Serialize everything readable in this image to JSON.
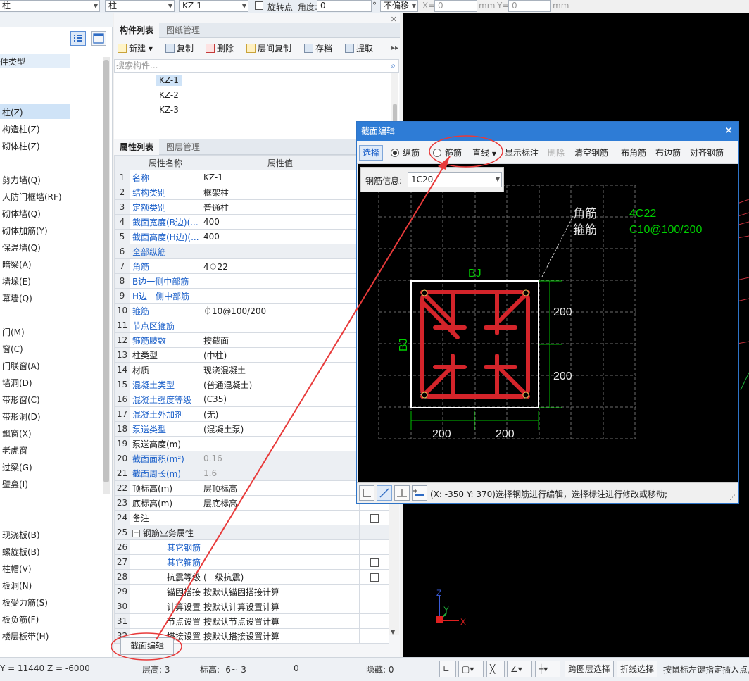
{
  "topbar": {
    "combo1": "柱",
    "combo2": "柱",
    "combo3": "KZ-1",
    "rotate_label": "旋转点",
    "angle_label": "角度:",
    "angle_value": "0",
    "degree": "°",
    "offset_value": "不偏移",
    "x_label": "X=",
    "x_value": "0",
    "mm1": "mm",
    "y_label": "Y=",
    "y_value": "0",
    "mm2": "mm"
  },
  "left_panel": {
    "header_partial": "件类型",
    "items": [
      {
        "label": "柱(Z)"
      },
      {
        "label": "构造柱(Z)"
      },
      {
        "label": "砌体柱(Z)"
      },
      {
        "label": "剪力墙(Q)"
      },
      {
        "label": "人防门框墙(RF)"
      },
      {
        "label": "砌体墙(Q)"
      },
      {
        "label": "砌体加筋(Y)"
      },
      {
        "label": "保温墙(Q)"
      },
      {
        "label": "暗梁(A)"
      },
      {
        "label": "墙垛(E)"
      },
      {
        "label": "幕墙(Q)"
      },
      {
        "label": "门(M)"
      },
      {
        "label": "窗(C)"
      },
      {
        "label": "门联窗(A)"
      },
      {
        "label": "墙洞(D)"
      },
      {
        "label": "带形窗(C)"
      },
      {
        "label": "带形洞(D)"
      },
      {
        "label": "飘窗(X)"
      },
      {
        "label": "老虎窗"
      },
      {
        "label": "过梁(G)"
      },
      {
        "label": "壁龛(I)"
      },
      {
        "label": "现浇板(B)"
      },
      {
        "label": "螺旋板(B)"
      },
      {
        "label": "柱帽(V)"
      },
      {
        "label": "板洞(N)"
      },
      {
        "label": "板受力筋(S)"
      },
      {
        "label": "板负筋(F)"
      },
      {
        "label": "楼层板带(H)"
      }
    ]
  },
  "component_panel": {
    "tab_active": "构件列表",
    "tab_other": "图纸管理",
    "toolbar": [
      "新建",
      "复制",
      "删除",
      "层间复制",
      "存档",
      "提取"
    ],
    "search_placeholder": "搜索构件...",
    "items": [
      "KZ-1",
      "KZ-2",
      "KZ-3"
    ]
  },
  "property_panel": {
    "tab_active": "属性列表",
    "tab_other": "图层管理",
    "col_name": "属性名称",
    "col_value": "属性值",
    "rows": [
      {
        "no": "1",
        "name": "名称",
        "value": "KZ-1"
      },
      {
        "no": "2",
        "name": "结构类别",
        "value": "框架柱"
      },
      {
        "no": "3",
        "name": "定额类别",
        "value": "普通柱"
      },
      {
        "no": "4",
        "name": "截面宽度(B边)(...",
        "value": "400"
      },
      {
        "no": "5",
        "name": "截面高度(H边)(...",
        "value": "400"
      },
      {
        "no": "6",
        "name": "全部纵筋",
        "value": ""
      },
      {
        "no": "7",
        "name": "角筋",
        "value": "4⏀22"
      },
      {
        "no": "8",
        "name": "B边一侧中部筋",
        "value": ""
      },
      {
        "no": "9",
        "name": "H边一侧中部筋",
        "value": ""
      },
      {
        "no": "10",
        "name": "箍筋",
        "value": "⏀10@100/200"
      },
      {
        "no": "11",
        "name": "节点区箍筋",
        "value": ""
      },
      {
        "no": "12",
        "name": "箍筋肢数",
        "value": "按截面"
      },
      {
        "no": "13",
        "name": "柱类型",
        "value": "(中柱)"
      },
      {
        "no": "14",
        "name": "材质",
        "value": "现浇混凝土"
      },
      {
        "no": "15",
        "name": "混凝土类型",
        "value": "(普通混凝土)"
      },
      {
        "no": "16",
        "name": "混凝土强度等级",
        "value": "(C35)"
      },
      {
        "no": "17",
        "name": "混凝土外加剂",
        "value": "(无)"
      },
      {
        "no": "18",
        "name": "泵送类型",
        "value": "(混凝土泵)"
      },
      {
        "no": "19",
        "name": "泵送高度(m)",
        "value": ""
      },
      {
        "no": "20",
        "name": "截面面积(m²)",
        "value": "0.16"
      },
      {
        "no": "21",
        "name": "截面周长(m)",
        "value": "1.6"
      },
      {
        "no": "22",
        "name": "顶标高(m)",
        "value": "层顶标高"
      },
      {
        "no": "23",
        "name": "底标高(m)",
        "value": "层底标高"
      },
      {
        "no": "24",
        "name": "备注",
        "value": ""
      },
      {
        "no": "25",
        "name": "钢筋业务属性",
        "value": ""
      },
      {
        "no": "26",
        "name": "其它钢筋",
        "value": ""
      },
      {
        "no": "27",
        "name": "其它箍筋",
        "value": ""
      },
      {
        "no": "28",
        "name": "抗震等级",
        "value": "(一级抗震)"
      },
      {
        "no": "29",
        "name": "锚固搭接",
        "value": "按默认锚固搭接计算"
      },
      {
        "no": "30",
        "name": "计算设置",
        "value": "按默认计算设置计算"
      },
      {
        "no": "31",
        "name": "节点设置",
        "value": "按默认节点设置计算"
      },
      {
        "no": "32",
        "name": "搭接设置",
        "value": "按默认搭接设置计算"
      }
    ],
    "bottom_button": "截面编辑"
  },
  "dialog": {
    "title": "截面编辑",
    "toolbar": {
      "select": "选择",
      "longitudinal": "纵筋",
      "stirrup": "箍筋",
      "line_mode": "直线",
      "show_dim": "显示标注",
      "delete": "删除",
      "clear": "清空钢筋",
      "corner": "布角筋",
      "edge": "布边筋",
      "align": "对齐钢筋"
    },
    "rebar_info_label": "钢筋信息:",
    "rebar_info_value": "1C20",
    "drawing": {
      "label_corner": "角筋",
      "label_stirrup": "箍筋",
      "value_corner": "4C22",
      "value_stirrup": "C10@100/200",
      "bj_top": "BJ",
      "bj_left": "BJ",
      "dim_right_1": "200",
      "dim_right_2": "200",
      "dim_bottom_1": "200",
      "dim_bottom_2": "200"
    },
    "status": "(X: -350 Y: 370)选择钢筋进行编辑，选择标注进行修改或移动;"
  },
  "statusbar": {
    "coord": "Y = 11440 Z = -6000",
    "floor_height": "层高:  3",
    "elevation": "标高:  -6~-3",
    "count": "0",
    "hidden": "隐藏:  0",
    "cross_layer": "跨图层选择",
    "polyline": "折线选择",
    "hint": "按鼠标左键指定插入点,"
  },
  "colors": {
    "accent": "#2e7cd6",
    "rebar": "#d4242a",
    "dim_green": "#00d000",
    "annotation_red": "#e83a3a"
  }
}
